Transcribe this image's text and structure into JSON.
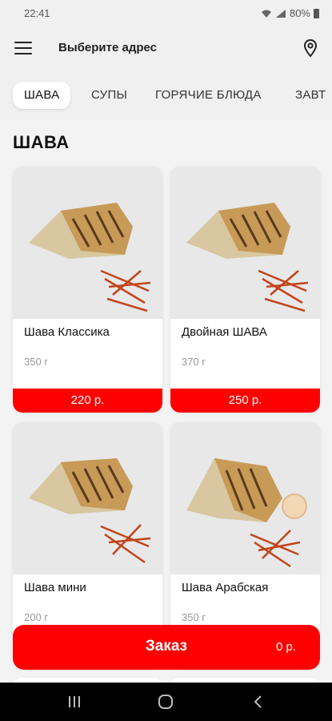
{
  "status_bar": {
    "time": "22:41",
    "battery": "80%"
  },
  "header": {
    "address_prompt": "Выберите адрес"
  },
  "tabs": [
    {
      "label": "ШАВА"
    },
    {
      "label": "СУПЫ"
    },
    {
      "label": "ГОРЯЧИЕ БЛЮДА"
    },
    {
      "label": "ЗАВТ"
    }
  ],
  "section": {
    "title": "ШАВА"
  },
  "products": [
    {
      "name": "Шава Классика",
      "weight": "350 г",
      "price": "220 р."
    },
    {
      "name": "Двойная ШАВА",
      "weight": "370 г",
      "price": "250 р."
    },
    {
      "name": "Шава мини",
      "weight": "200 г"
    },
    {
      "name": "Шава Арабская",
      "weight": "350 г"
    }
  ],
  "order": {
    "label": "Заказ",
    "total": "0 р."
  },
  "colors": {
    "accent": "#ff0000",
    "background": "#f3f3f3"
  }
}
